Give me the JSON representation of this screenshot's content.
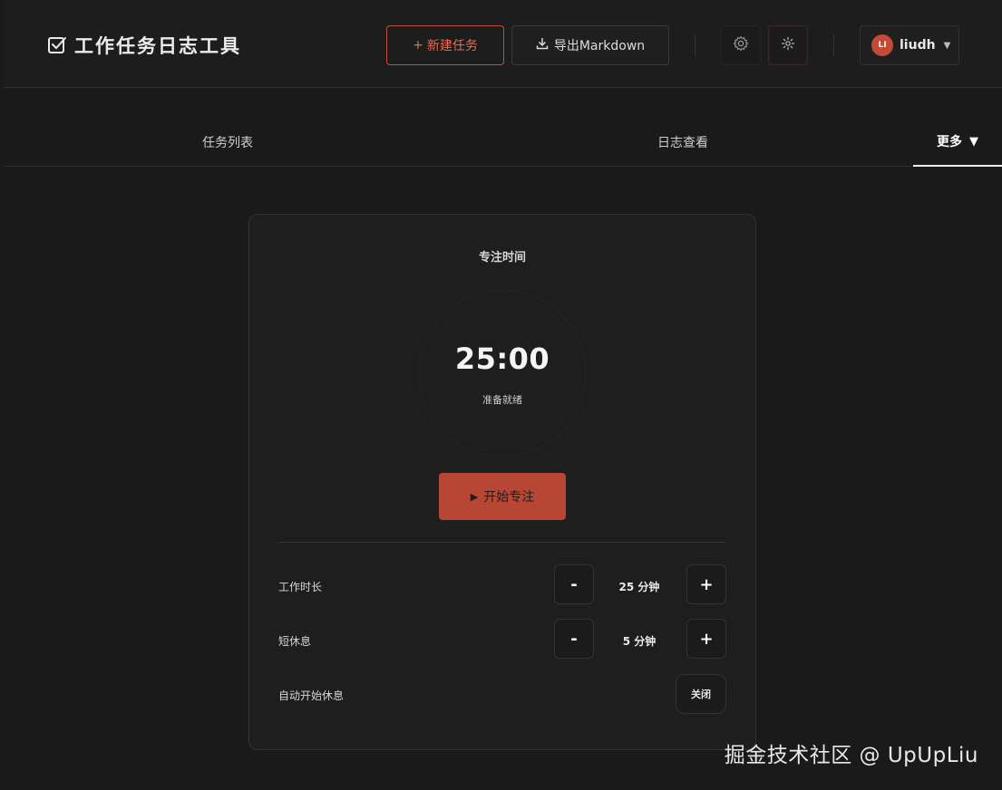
{
  "header": {
    "title": "工作任务日志工具",
    "new_task_label": "新建任务",
    "export_label": "导出Markdown",
    "user": {
      "initials": "LI",
      "name": "liudh"
    }
  },
  "tabs": [
    {
      "label": "任务列表"
    },
    {
      "label": "日志查看"
    },
    {
      "label": "更多"
    }
  ],
  "pomodoro": {
    "title": "专注时间",
    "time": "25:00",
    "status": "准备就绪",
    "start_label": "开始专注",
    "settings": {
      "work_label": "工作时长",
      "work_value": "25 分钟",
      "short_break_label": "短休息",
      "short_break_value": "5 分钟",
      "auto_break_label": "自动开始休息",
      "auto_break_value": "关闭",
      "minus": "-",
      "plus": "+"
    }
  },
  "watermark": "掘金技术社区 @ UpUpLiu",
  "colors": {
    "accent": "#b84634",
    "accent_text": "#e26b55",
    "background": "#1a1a1a",
    "card": "#1e1e1e"
  }
}
